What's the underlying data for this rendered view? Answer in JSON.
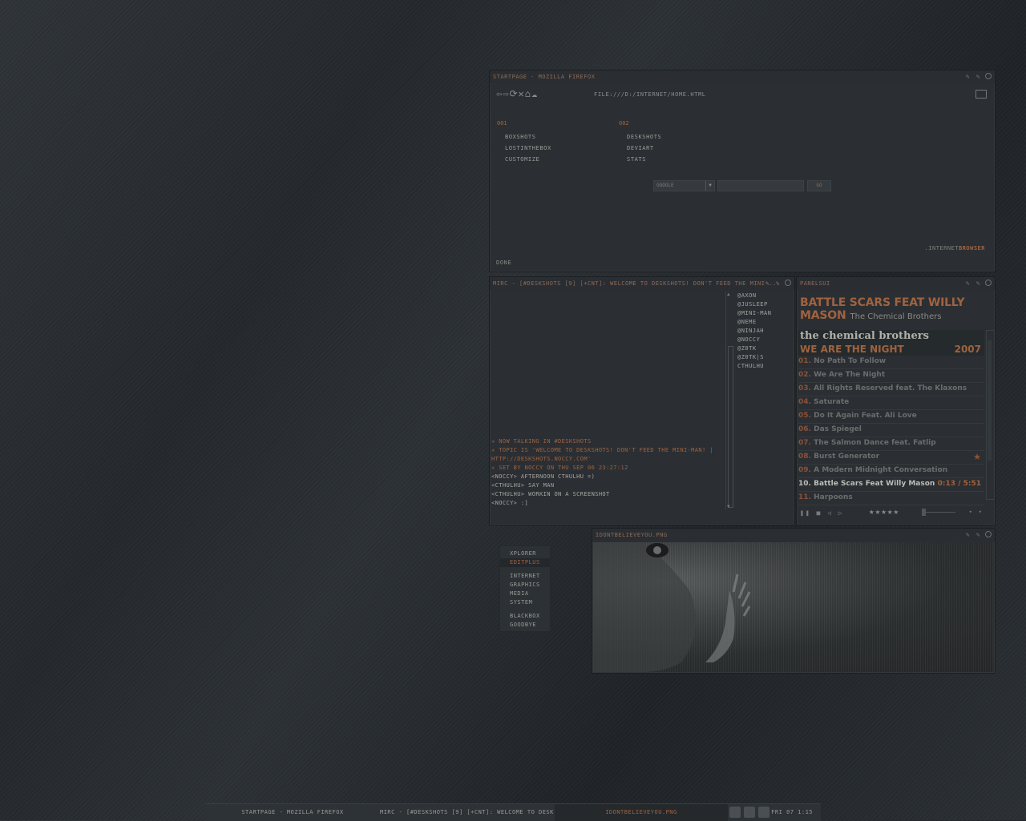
{
  "firefox": {
    "title": "startpage - mozilla firefox",
    "url": "file:///d:/internet/home.html",
    "col1": {
      "header": "001",
      "links": [
        "boxshots",
        "lostinthebox",
        "customize"
      ]
    },
    "col2": {
      "header": "002",
      "links": [
        "deskshots",
        "deviart",
        "stats"
      ]
    },
    "search_engine": "google",
    "search_button": "go",
    "brand_a": ".internet",
    "brand_b": "browser",
    "status": "done"
  },
  "mirc": {
    "title": "mirc - [#deskshots [9] [+cnt]: welcome to deskshots! don't feed the mini-...",
    "messages": [
      {
        "type": "sys",
        "text": "✳ now talking in #deskshots"
      },
      {
        "type": "sys",
        "text": "✳ topic is 'welcome to deskshots! don't feed the mini-man! |"
      },
      {
        "type": "sys",
        "text": "http://deskshots.noccy.com'"
      },
      {
        "type": "sys",
        "text": "✳ set by noccy on thu sep 06 23:27:12"
      },
      {
        "type": "usr",
        "text": "<noccy> afternoon cthulhu =)"
      },
      {
        "type": "usr",
        "text": "<cthulhu> say man"
      },
      {
        "type": "usr",
        "text": "<cthulhu> workin on a screenshot"
      },
      {
        "type": "usr",
        "text": "<noccy> :]"
      }
    ],
    "nicks": [
      "@axon",
      "@jusleep",
      "@mini-man",
      "@neme",
      "@ninjah",
      "@noccy",
      "@z0tk",
      "@z0tk|s",
      "cthulhu"
    ]
  },
  "panel": {
    "title": "panelsui",
    "now_playing": "BATTLE SCARS FEAT WILLY MASON",
    "artist": "The Chemical Brothers",
    "album_artist": "the chemical brothers",
    "album": "WE ARE THE NIGHT",
    "year": "2007",
    "current_time": "0:13 / 5:51",
    "rating": "★★★★★",
    "tracks": [
      {
        "num": "01.",
        "name": "No Path To Follow"
      },
      {
        "num": "02.",
        "name": "We Are The Night"
      },
      {
        "num": "03.",
        "name": "All Rights Reserved feat. The Klaxons"
      },
      {
        "num": "04.",
        "name": "Saturate"
      },
      {
        "num": "05.",
        "name": "Do It Again Feat. Ali Love"
      },
      {
        "num": "06.",
        "name": "Das Spiegel"
      },
      {
        "num": "07.",
        "name": "The Salmon Dance feat. Fatlip"
      },
      {
        "num": "08.",
        "name": "Burst Generator"
      },
      {
        "num": "09.",
        "name": "A Modern Midnight Conversation"
      },
      {
        "num": "10.",
        "name": "Battle Scars Feat Willy Mason"
      },
      {
        "num": "11.",
        "name": "Harpoons"
      }
    ]
  },
  "viewer": {
    "title": "idontbelieveyou.png"
  },
  "bbmenu": {
    "items_a": [
      "xplorer",
      "editplus"
    ],
    "items_b": [
      "internet",
      "graphics",
      "media",
      "system"
    ],
    "items_c": [
      "blackbox",
      "goodbye"
    ]
  },
  "taskbar": {
    "task1": "startpage - mozilla firefox",
    "task2": "mirc - [#deskshots [9] [+cnt]: welcome to desk...",
    "task3": "idontbelieveyou.png",
    "clock": "fri 07 1:15"
  },
  "colors": {
    "accent": "#a0623f",
    "text": "#9a9a94",
    "window": "#2b2f33"
  }
}
